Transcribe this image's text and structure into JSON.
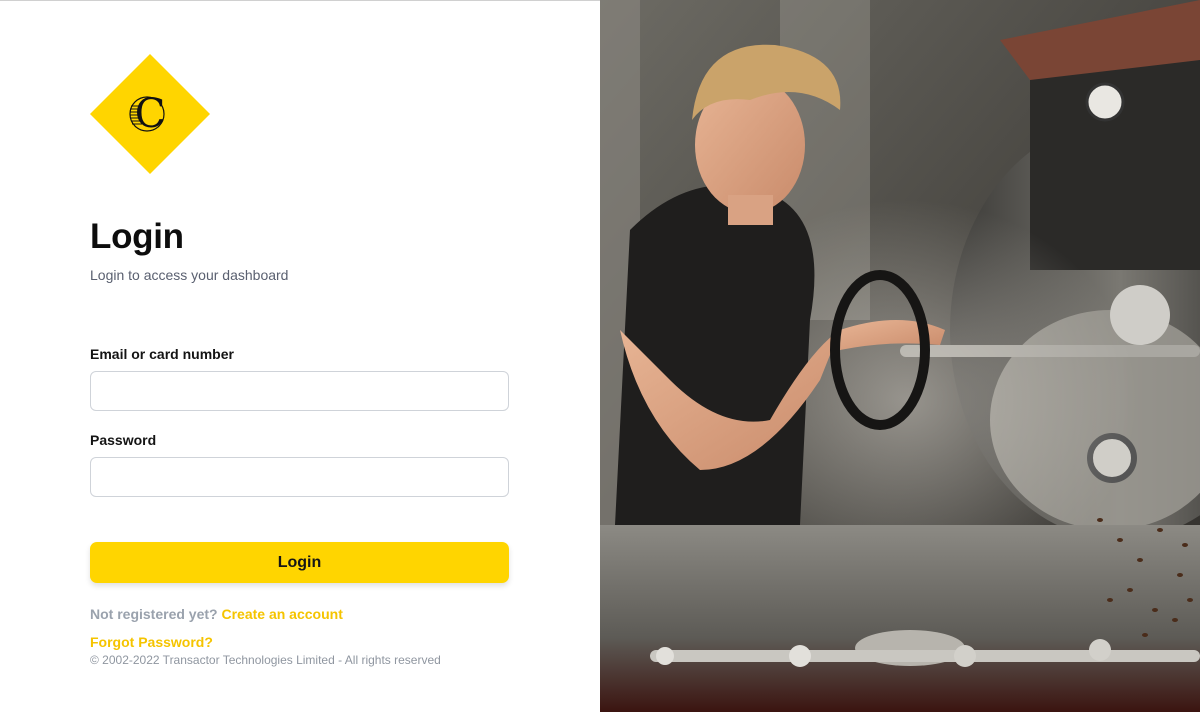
{
  "brand": {
    "logo_letter": "C",
    "accent_color": "#ffd500",
    "link_color": "#f5c400"
  },
  "login": {
    "title": "Login",
    "subtitle": "Login to access your dashboard",
    "email_label": "Email or card number",
    "email_value": "",
    "password_label": "Password",
    "password_value": "",
    "submit_label": "Login",
    "not_registered_text": "Not registered yet?",
    "create_account_link": "Create an account",
    "forgot_password_link": "Forgot Password?",
    "copyright": "© 2002-2022 Transactor Technologies Limited - All rights reserved"
  },
  "hero": {
    "subject": "coffee-roaster-photo"
  }
}
